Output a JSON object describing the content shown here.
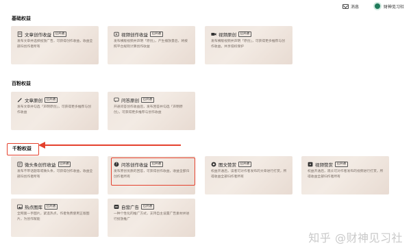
{
  "header": {
    "messages_label": "消息",
    "user_name": "财神见习社"
  },
  "sections": {
    "basic": "基础权益",
    "hundred": "百粉权益",
    "thousand": "千粉权益"
  },
  "cards": {
    "article": {
      "title": "文章创作收益",
      "badge": "已开通",
      "desc": "发布文章并选择投放广告，可获得创作收益，收益全部归创作者所有"
    },
    "video": {
      "title": "视频创作收益",
      "badge": "已开通",
      "desc": "发布横版视频并声明「原创」，产生播放量后，将按照平台规则计算创作收益"
    },
    "video_original": {
      "title": "视频原创",
      "badge": "已开通",
      "desc": "发布横版视频并声明「原创」，可获得更多推荐与创作收益，共享侵权保护"
    },
    "article_original": {
      "title": "文章原创",
      "badge": "已开通",
      "desc": "发布文章并勾选「声明原创」，可获得更多推荐与创作收益"
    },
    "qa_original": {
      "title": "问答原创",
      "badge": "已开通",
      "desc": "开通问答创作收益后，发布回答并勾选「声明原创」，可获得更多推荐与创作收益"
    },
    "microheadline": {
      "title": "微头条创作收益",
      "badge": "已开通",
      "desc": "发布不带话题等或微头条，可获得创作收益，收益全部归创作者所有"
    },
    "qa_income": {
      "title": "问答创作收益",
      "badge": "已开通",
      "desc": "发布原创优质的回答，可获得创作收益，收益全部归创作者所有"
    },
    "imagetext_reward": {
      "title": "图文赞赏",
      "badge": "已开通",
      "desc": "权益开通后，读者可对作者发布的文章进行打赏，所得收益全部归作者所有"
    },
    "video_reward": {
      "title": "视频赞赏",
      "badge": "已开通",
      "desc": "权益开通后，观众可对作者发布的视频进行打赏，所得收益全部归作者所有"
    },
    "hot_gallery": {
      "title": "热点图库",
      "badge": "已开通",
      "desc": "全网第一手图片，紧追热点，作者免费使用正版图片，为创作赋能"
    },
    "self_ads": {
      "title": "自营广告",
      "badge": "已开通",
      "desc": "一种个性化的推广方式，支持自主设置广告素材并进行投放推广"
    }
  },
  "watermark": "知乎 @财神见习社",
  "colors": {
    "card_bg": "#efe6df",
    "highlight": "#e4402c"
  }
}
